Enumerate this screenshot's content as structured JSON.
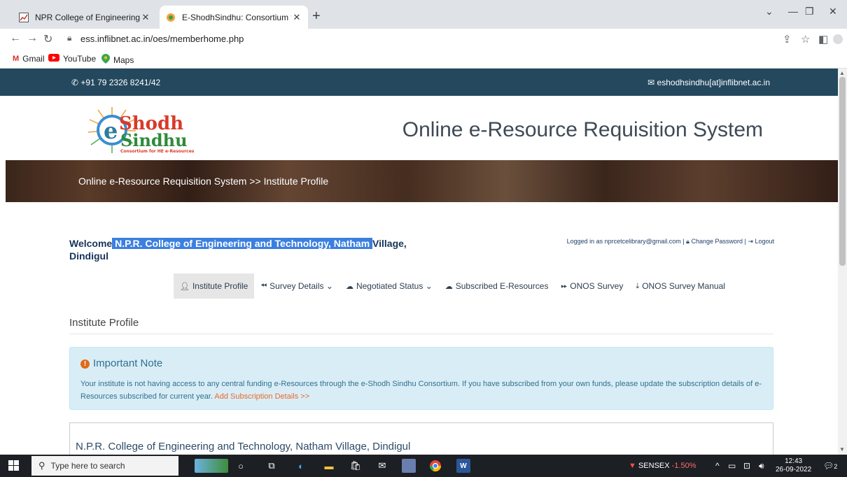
{
  "browser": {
    "tabs": [
      {
        "title": "NPR College of Engineering & Te",
        "active": false
      },
      {
        "title": "E-ShodhSindhu: Consortium for",
        "active": true
      }
    ],
    "new_tab": "+",
    "url": "ess.inflibnet.ac.in/oes/memberhome.php",
    "bookmarks": [
      "Gmail",
      "YouTube",
      "Maps"
    ]
  },
  "site": {
    "phone": "+91 79 2326 8241/42",
    "email": "eshodhsindhu[at]inflibnet.ac.in",
    "logo_top": "Shodh",
    "logo_bottom": "Sindhu",
    "logo_tagline": "Consortium for HE e-Resources",
    "system_name": "Online e-Resource Requisition System",
    "breadcrumb": "Online e-Resource Requisition System >> Institute Profile"
  },
  "welcome": {
    "prefix": "Welcome",
    "institute_highlighted": "N.P.R. College of Engineering and Technology, Natham",
    "institute_rest": "Village,",
    "city": "Dindigul"
  },
  "login": {
    "logged_in": "Logged in as nprcetcelibrary@gmail.com",
    "sep": "|",
    "change_password": "Change Password",
    "logout": "Logout"
  },
  "nav": [
    {
      "label": "Institute Profile",
      "icon": "user-icon",
      "dropdown": false
    },
    {
      "label": "Survey Details",
      "icon": "rewind-icon",
      "dropdown": true
    },
    {
      "label": "Negotiated Status",
      "icon": "cloud-icon",
      "dropdown": true
    },
    {
      "label": "Subscribed E-Resources",
      "icon": "cloud-icon",
      "dropdown": false
    },
    {
      "label": "ONOS Survey",
      "icon": "forward-icon",
      "dropdown": false
    },
    {
      "label": "ONOS Survey Manual",
      "icon": "download-icon",
      "dropdown": false
    }
  ],
  "section_title": "Institute Profile",
  "note": {
    "heading": "Important Note",
    "body": "Your institute is not having access to any central funding e-Resources through the e-Shodh Sindhu Consortium. If you have subscribed from your own funds, please update the subscription details of e-Resources subscribed for current year.",
    "link": "Add Subscription Details >>"
  },
  "profile_name": "N.P.R. College of Engineering and Technology, Natham Village, Dindigul",
  "taskbar": {
    "search_placeholder": "Type here to search",
    "sensex_label": "SENSEX",
    "sensex_change": "-1.50%",
    "time": "12:43",
    "date": "26-09-2022",
    "notifications": "2"
  },
  "colors": {
    "top_strip": "#24485e",
    "highlight": "#3b7fe0",
    "note_bg": "#d9edf7",
    "link": "#e8692a"
  }
}
